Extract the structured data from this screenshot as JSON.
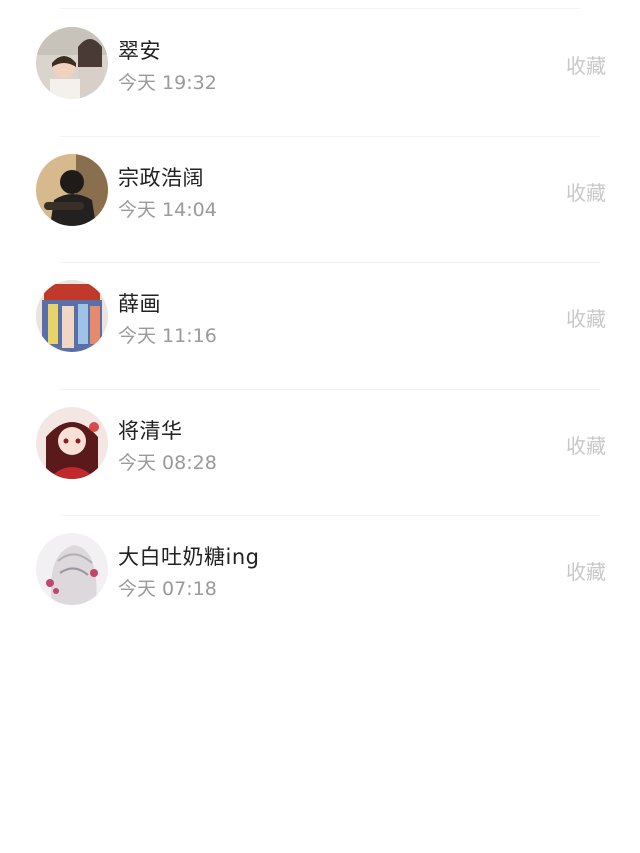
{
  "list": {
    "items": [
      {
        "name": "翠安",
        "time": "今天 19:32",
        "action_label": "收藏"
      },
      {
        "name": "宗政浩阔",
        "time": "今天 14:04",
        "action_label": "收藏"
      },
      {
        "name": "薛画",
        "time": "今天 11:16",
        "action_label": "收藏"
      },
      {
        "name": "将清华",
        "time": "今天 08:28",
        "action_label": "收藏"
      },
      {
        "name": "大白吐奶糖ing",
        "time": "今天 07:18",
        "action_label": "收藏"
      }
    ]
  },
  "colors": {
    "name_text": "#222222",
    "time_text": "#9a9a9a",
    "action_text": "#c8c8c8",
    "divider": "#f2f2f2"
  }
}
